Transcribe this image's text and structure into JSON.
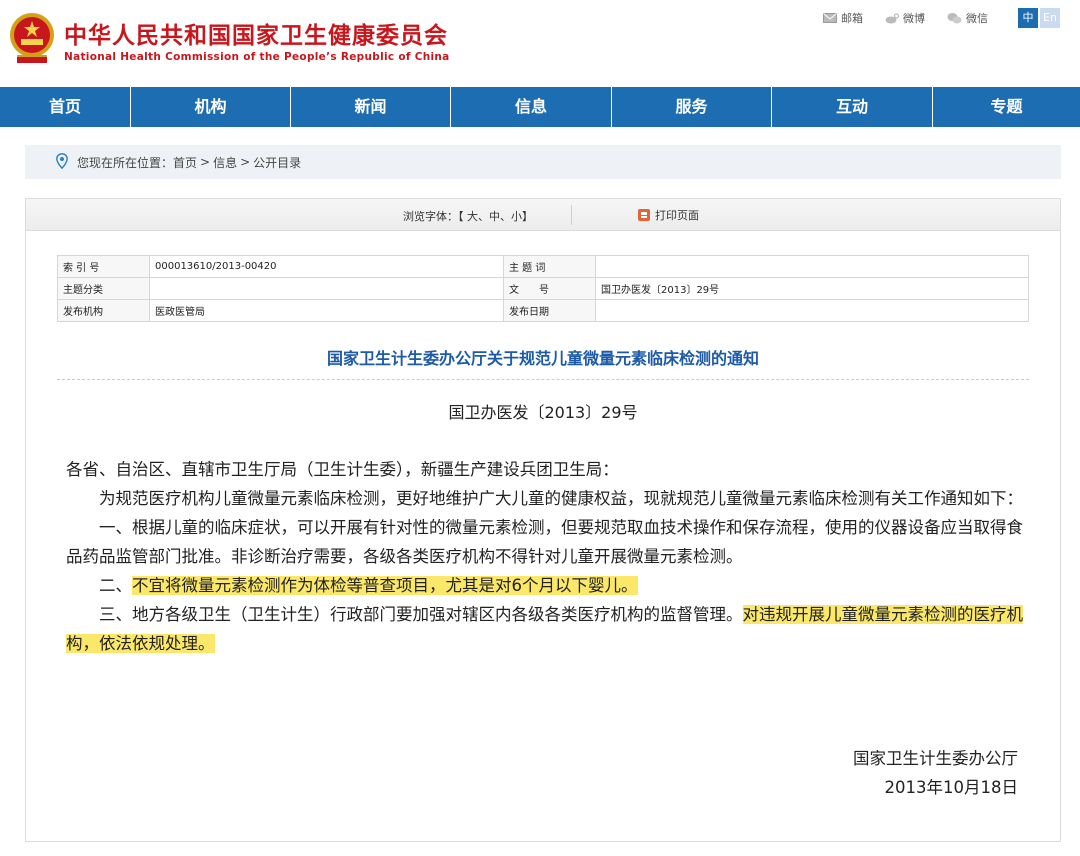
{
  "header": {
    "title": "中华人民共和国国家卫生健康委员会",
    "subtitle": "National Health Commission of the People’s Republic of China",
    "links": [
      {
        "label": "邮箱",
        "icon": "mail-icon"
      },
      {
        "label": "微博",
        "icon": "weibo-icon"
      },
      {
        "label": "微信",
        "icon": "wechat-icon"
      }
    ],
    "lang": {
      "zh": "中",
      "en": "En"
    }
  },
  "nav": {
    "items": [
      "首页",
      "机构",
      "新闻",
      "信息",
      "服务",
      "互动",
      "专题"
    ]
  },
  "breadcrumb": {
    "label": "您现在所在位置：",
    "items": [
      "首页",
      "信息",
      "公开目录"
    ],
    "separator": ">"
  },
  "toolbar": {
    "font_label": "浏览字体：【 大、中、小】",
    "print_label": "打印页面"
  },
  "meta": {
    "index_key": "索 引 号",
    "index_value": "000013610/2013-00420",
    "subject_word_key": "主 题 词",
    "subject_word_value": "",
    "category_key": "主题分类",
    "category_value": "",
    "doc_no_key": "文　　号",
    "doc_no_value": "国卫办医发〔2013〕29号",
    "org_key": "发布机构",
    "org_value": "医政医管局",
    "date_key": "发布日期",
    "date_value": ""
  },
  "doc": {
    "title": "国家卫生计生委办公厅关于规范儿童微量元素临床检测的通知",
    "number": "国卫办医发〔2013〕29号",
    "salutation": "各省、自治区、直辖市卫生厅局（卫生计生委），新疆生产建设兵团卫生局：",
    "intro": "为规范医疗机构儿童微量元素临床检测，更好地维护广大儿童的健康权益，现就规范儿童微量元素临床检测有关工作通知如下：",
    "item1": "一、根据儿童的临床症状，可以开展有针对性的微量元素检测，但要规范取血技术操作和保存流程，使用的仪器设备应当取得食品药品监管部门批准。非诊断治疗需要，各级各类医疗机构不得针对儿童开展微量元素检测。",
    "item2_prefix": "二、",
    "item2_highlight": "不宜将微量元素检测作为体检等普查项目，尤其是对6个月以下婴儿。",
    "item3_text": "三、地方各级卫生（卫生计生）行政部门要加强对辖区内各级各类医疗机构的监督管理。",
    "item3_highlight": "对违规开展儿童微量元素检测的医疗机构，依法依规处理。",
    "signer": "国家卫生计生委办公厅",
    "date": "2013年10月18日"
  },
  "colors": {
    "brand_red": "#c8161d",
    "nav_blue": "#1d6db3",
    "title_blue": "#1d5ba8",
    "highlight": "#fbe86a"
  }
}
